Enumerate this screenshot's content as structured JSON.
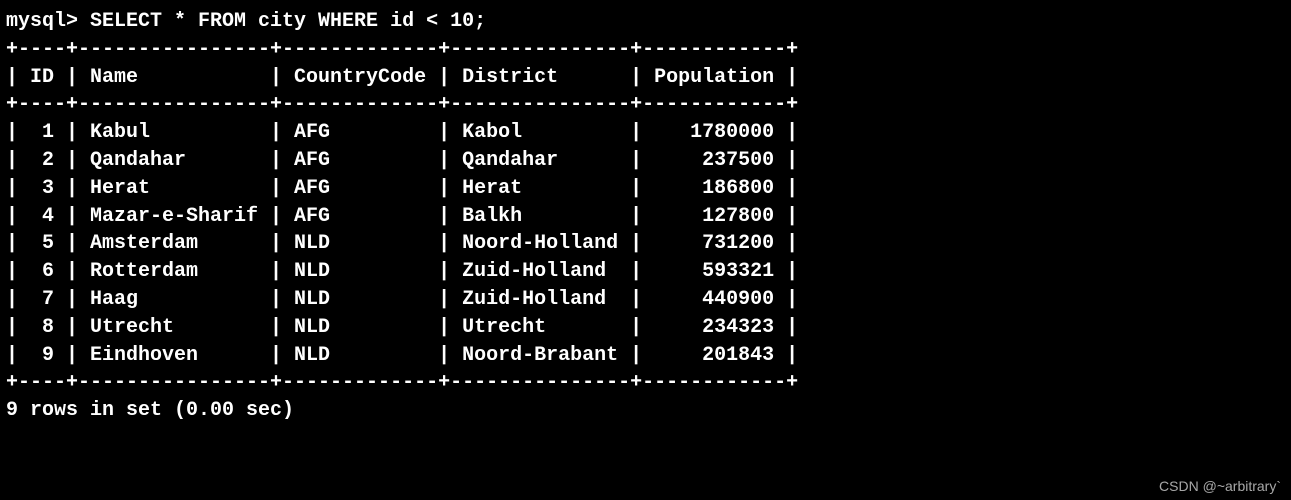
{
  "query": "SELECT * FROM city WHERE id < 10;",
  "prompt": "mysql> ",
  "border": {
    "top": "+----+----------------+-------------+---------------+------------+",
    "header": "| ID | Name           | CountryCode | District      | Population |",
    "mid": "+----+----------------+-------------+---------------+------------+",
    "bottom": "+----+----------------+-------------+---------------+------------+"
  },
  "chart_data": {
    "type": "table",
    "columns": [
      "ID",
      "Name",
      "CountryCode",
      "District",
      "Population"
    ],
    "rows": [
      {
        "id": 1,
        "name": "Kabul",
        "country": "AFG",
        "district": "Kabol",
        "pop": 1780000
      },
      {
        "id": 2,
        "name": "Qandahar",
        "country": "AFG",
        "district": "Qandahar",
        "pop": 237500
      },
      {
        "id": 3,
        "name": "Herat",
        "country": "AFG",
        "district": "Herat",
        "pop": 186800
      },
      {
        "id": 4,
        "name": "Mazar-e-Sharif",
        "country": "AFG",
        "district": "Balkh",
        "pop": 127800
      },
      {
        "id": 5,
        "name": "Amsterdam",
        "country": "NLD",
        "district": "Noord-Holland",
        "pop": 731200
      },
      {
        "id": 6,
        "name": "Rotterdam",
        "country": "NLD",
        "district": "Zuid-Holland",
        "pop": 593321
      },
      {
        "id": 7,
        "name": "Haag",
        "country": "NLD",
        "district": "Zuid-Holland",
        "pop": 440900
      },
      {
        "id": 8,
        "name": "Utrecht",
        "country": "NLD",
        "district": "Utrecht",
        "pop": 234323
      },
      {
        "id": 9,
        "name": "Eindhoven",
        "country": "NLD",
        "district": "Noord-Brabant",
        "pop": 201843
      }
    ]
  },
  "status": "9 rows in set (0.00 sec)",
  "watermark": "CSDN @~arbitrary`"
}
